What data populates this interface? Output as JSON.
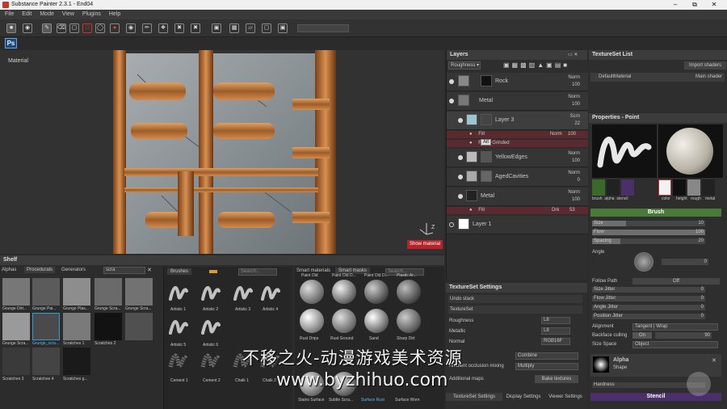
{
  "window": {
    "title": "Substance Painter 2.3.1 - End04"
  },
  "menu": [
    "File",
    "Edit",
    "Mode",
    "View",
    "Plugins",
    "Help"
  ],
  "photoshop_tab": "Ps",
  "viewport": {
    "label": "Material",
    "show_material": "Show material",
    "axis": "Z"
  },
  "layers": {
    "title": "Layers",
    "channel": "Roughness",
    "items": [
      {
        "name": "Rock",
        "blend": "Norm",
        "opacity": "100"
      },
      {
        "name": "Metal",
        "blend": "Norm",
        "opacity": "100"
      },
      {
        "name": "Layer 3",
        "blend": "Scrn",
        "opacity": "22",
        "tooltip": "Alt"
      },
      {
        "name": "YellowEdges",
        "blend": "Norm",
        "opacity": "100"
      },
      {
        "name": "AgedCavities",
        "blend": "Norm",
        "opacity": "0"
      },
      {
        "name": "Metal",
        "blend": "Norm",
        "opacity": "100"
      },
      {
        "name": "Layer 1",
        "blend": "Norm",
        "opacity": "100"
      }
    ],
    "subs": [
      {
        "name": "Fill",
        "blend": "Norm",
        "opacity": "100"
      },
      {
        "name": "Fresh Grinded"
      },
      {
        "name": "Fill",
        "blend": "Drk",
        "opacity": "53"
      }
    ]
  },
  "textureset_list": {
    "title": "TextureSet List",
    "import": "Import shaders",
    "material": "DefaultMaterial",
    "shader": "Main shader"
  },
  "properties": {
    "title": "Properties - Point",
    "slots": [
      "brush",
      "alpha",
      "stencil",
      "color",
      "height",
      "rough",
      "metal"
    ],
    "brush_header": "Brush",
    "size_label": "Size",
    "size_val": "10",
    "size_fill": 0.3,
    "flow_label": "Flow",
    "flow_val": "100",
    "flow_fill": 1.0,
    "spacing_label": "Spacing",
    "spacing_val": "20",
    "spacing_fill": 0.25,
    "angle_label": "Angle",
    "angle_val": "0",
    "follow_path": "Follow Path",
    "follow_val": "Off",
    "size_jitter": "Size Jitter",
    "flow_jitter": "Flow Jitter",
    "angle_jitter": "Angle Jitter",
    "position_jitter": "Position Jitter",
    "jitter_val": "0",
    "alignment_label": "Alignment",
    "alignment_val": "Tangent | Wrap",
    "backface_label": "Backface culling",
    "backface_toggle": "On",
    "backface_val": "90",
    "sizespace_label": "Size Space",
    "sizespace_val": "Object",
    "alpha_title": "Alpha",
    "alpha_sub": "Shape",
    "hardness": "Hardness",
    "stencil_header": "Stencil"
  },
  "shelf": {
    "title": "Shelf",
    "tabs": [
      "Alphas",
      "Procedurals",
      "Generators"
    ],
    "search": "scra",
    "items": [
      "Grunge Dirt...",
      "Grunge Pai...",
      "Grunge Plas...",
      "Grunge Scra...",
      "Grunge Scra...",
      "Grunge Scra...",
      "Grunge_scra...",
      "Scratches 1",
      "Scratches 2",
      "Scratches 3",
      "Scratches 4",
      "Scratches g..."
    ],
    "brushes_tab": "Brushes",
    "brushes": [
      "Artistic 1",
      "Artistic 2",
      "Artistic 3",
      "Artistic 4",
      "Artistic 5",
      "Artistic 6",
      "Cement 1",
      "Cement 2",
      "Chalk 1",
      "Chalk 2"
    ],
    "smart_tabs": [
      "Smart materials",
      "Smart masks"
    ],
    "smart": [
      "Paint Old",
      "Paint Old D...",
      "Paint Old D...",
      "Plastic Ar...",
      "Rust Drips",
      "Rust Ground",
      "Sand",
      "Sharp Dirt"
    ],
    "smart_bottom": [
      "Stains Surface",
      "Subtle Scra...",
      "Surface Rust",
      "Surface Worn"
    ],
    "search_placeholder": "Search..."
  },
  "tss": {
    "title": "TextureSet Settings",
    "undo": "Undo stack",
    "textureset": "TextureSet",
    "rows": [
      {
        "label": "Roughness",
        "val": "L8"
      },
      {
        "label": "Metallic",
        "val": "L8"
      },
      {
        "label": "Normal",
        "val": "RGB16F"
      }
    ],
    "combine": "Combine",
    "ao_label": "Ambient occlusion mixing",
    "ao_val": "Multiply",
    "additional": "Additional maps",
    "bake": "Bake textures",
    "bottom_tabs": [
      "TextureSet Settings",
      "Display Settings",
      "Viewer Settings"
    ]
  },
  "watermark": {
    "line1": "不移之火-动漫游戏美术资源",
    "line2": "www.byzhihuo.com"
  }
}
